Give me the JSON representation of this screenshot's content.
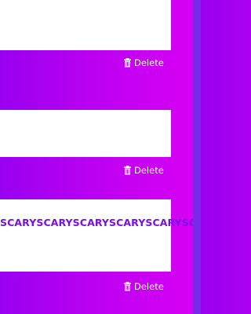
{
  "cards": [
    {
      "text": "",
      "delete_label": "Delete"
    },
    {
      "text": "",
      "delete_label": "Delete"
    },
    {
      "text": "SCARYSCARYSCARYSCARYSCARYSCA",
      "delete_label": "Delete"
    }
  ],
  "colors": {
    "background_left": "#9a00f0",
    "background_right": "#d800f4",
    "strip": "#7a2ae6",
    "card": "#ffffff",
    "text": "#7a0ee6"
  }
}
